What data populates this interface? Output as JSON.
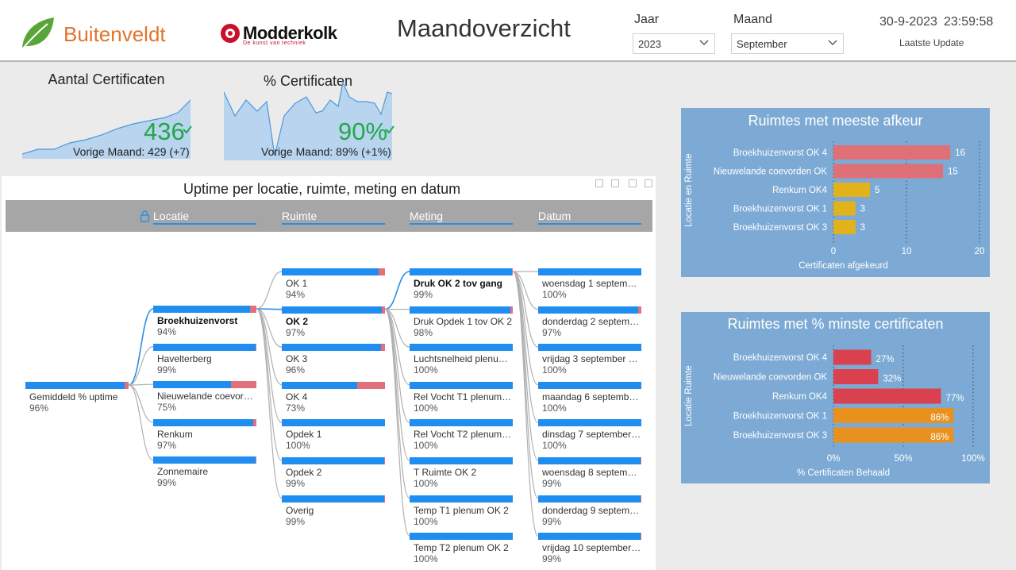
{
  "header": {
    "brand_left": "Buitenveldt",
    "brand_right": "Modderkolk",
    "brand_right_tagline": "De kunst van techniek",
    "title": "Maandoverzicht",
    "year_label": "Jaar",
    "year_value": "2023",
    "month_label": "Maand",
    "month_value": "September",
    "date": "30-9-2023",
    "time": "23:59:58",
    "update_label": "Laatste Update"
  },
  "kpis": [
    {
      "title": "Aantal Certificaten",
      "value": "436",
      "sub": "Vorige Maand: 429 (+7)"
    },
    {
      "title": "% Certificaten",
      "value": "90%",
      "sub": "Vorige Maand: 89% (+1%)"
    }
  ],
  "decomp": {
    "title": "Uptime per locatie, ruimte, meting en datum",
    "columns": [
      "Locatie",
      "Ruimte",
      "Meting",
      "Datum"
    ],
    "root": {
      "name": "Gemiddeld % uptime",
      "value": "96%",
      "frac": 0.96
    },
    "locatie": [
      {
        "name": "Broekhuizenvorst",
        "value": "94%",
        "frac": 0.94,
        "bold": true
      },
      {
        "name": "Havelterberg",
        "value": "99%",
        "frac": 0.99
      },
      {
        "name": "Nieuwelande coevorden",
        "value": "75%",
        "frac": 0.75
      },
      {
        "name": "Renkum",
        "value": "97%",
        "frac": 0.97
      },
      {
        "name": "Zonnemaire",
        "value": "99%",
        "frac": 0.99
      }
    ],
    "ruimte": [
      {
        "name": "OK 1",
        "value": "94%",
        "frac": 0.94
      },
      {
        "name": "OK 2",
        "value": "97%",
        "frac": 0.97,
        "bold": true
      },
      {
        "name": "OK 3",
        "value": "96%",
        "frac": 0.96
      },
      {
        "name": "OK 4",
        "value": "73%",
        "frac": 0.73
      },
      {
        "name": "Opdek 1",
        "value": "100%",
        "frac": 1.0
      },
      {
        "name": "Opdek 2",
        "value": "99%",
        "frac": 0.99
      },
      {
        "name": "Overig",
        "value": "99%",
        "frac": 0.99
      }
    ],
    "meting": [
      {
        "name": "Druk OK 2 tov gang",
        "value": "99%",
        "frac": 0.99,
        "bold": true
      },
      {
        "name": "Druk Opdek 1 tov OK 2",
        "value": "98%",
        "frac": 0.98
      },
      {
        "name": "Luchtsnelheid plenum ...",
        "value": "100%",
        "frac": 1.0
      },
      {
        "name": "Rel Vocht T1 plenum O...",
        "value": "100%",
        "frac": 1.0
      },
      {
        "name": "Rel Vocht T2 plenum O...",
        "value": "100%",
        "frac": 1.0
      },
      {
        "name": "T Ruimte OK 2",
        "value": "100%",
        "frac": 1.0
      },
      {
        "name": "Temp T1 plenum OK 2",
        "value": "100%",
        "frac": 1.0
      },
      {
        "name": "Temp T2 plenum OK 2",
        "value": "100%",
        "frac": 1.0
      }
    ],
    "datum": [
      {
        "name": "woensdag 1 septembe...",
        "value": "100%",
        "frac": 1.0
      },
      {
        "name": "donderdag 2 septemb...",
        "value": "97%",
        "frac": 0.97
      },
      {
        "name": "vrijdag 3 september 2...",
        "value": "100%",
        "frac": 1.0
      },
      {
        "name": "maandag 6 september...",
        "value": "100%",
        "frac": 1.0
      },
      {
        "name": "dinsdag 7 september ...",
        "value": "100%",
        "frac": 1.0
      },
      {
        "name": "woensdag 8 septembe...",
        "value": "99%",
        "frac": 0.99
      },
      {
        "name": "donderdag 9 septemb...",
        "value": "99%",
        "frac": 0.99
      },
      {
        "name": "vrijdag 10 september ...",
        "value": "99%",
        "frac": 0.99
      }
    ]
  },
  "chart_data": [
    {
      "type": "bar",
      "orientation": "horizontal",
      "title": "Ruimtes met meeste afkeur",
      "xlabel": "Certificaten afgekeurd",
      "ylabel": "Locatie en Ruimte",
      "categories": [
        "Broekhuizenvorst OK 4",
        "Nieuwelande coevorden OK",
        "Renkum OK4",
        "Broekhuizenvorst OK 1",
        "Broekhuizenvorst OK 3"
      ],
      "values": [
        16,
        15,
        5,
        3,
        3
      ],
      "data_labels": [
        "16",
        "15",
        "5",
        "3",
        "3"
      ],
      "bar_colors": [
        "#e07077",
        "#e07077",
        "#e2b21a",
        "#e2b21a",
        "#e2b21a"
      ],
      "xlim": [
        0,
        20
      ],
      "xticks": [
        "0",
        "10",
        "20"
      ],
      "grid": true
    },
    {
      "type": "bar",
      "orientation": "horizontal",
      "title": "Ruimtes met % minste certificaten",
      "xlabel": "% Certificaten Behaald",
      "ylabel": "Locatie Ruimte",
      "categories": [
        "Broekhuizenvorst OK 4",
        "Nieuwelande coevorden OK",
        "Renkum OK4",
        "Broekhuizenvorst OK 1",
        "Broekhuizenvorst OK 3"
      ],
      "values": [
        27,
        32,
        77,
        86,
        86
      ],
      "data_labels": [
        "27%",
        "32%",
        "77%",
        "86%",
        "86%"
      ],
      "bar_colors": [
        "#d9414f",
        "#d9414f",
        "#d9414f",
        "#e8911f",
        "#e8911f"
      ],
      "xlim": [
        0,
        100
      ],
      "xticks": [
        "0%",
        "50%",
        "100%"
      ],
      "grid": true
    }
  ]
}
